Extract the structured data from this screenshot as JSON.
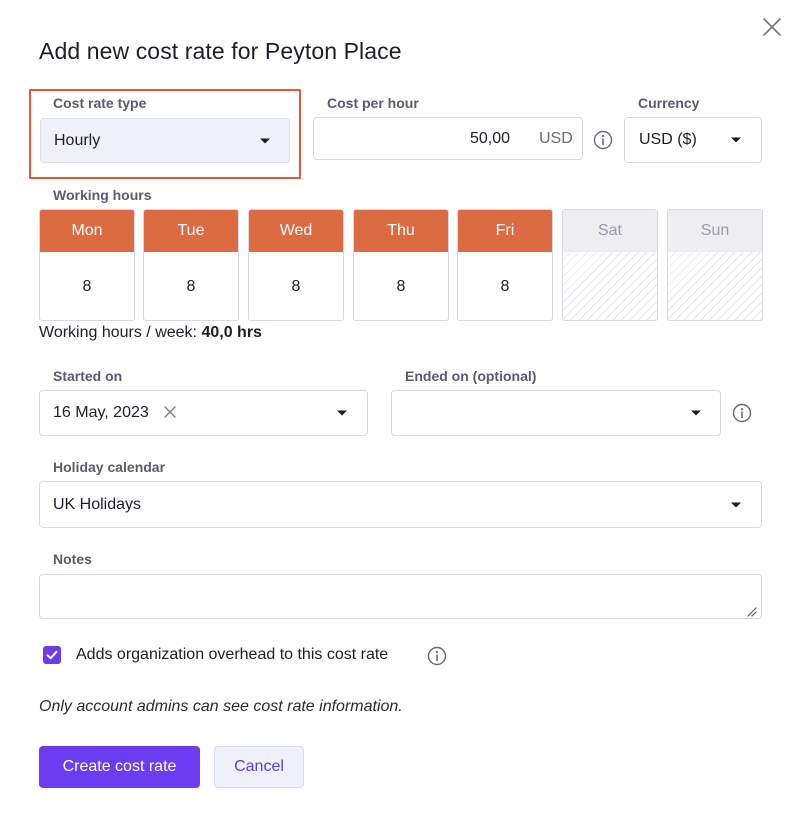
{
  "dialog": {
    "title": "Add new cost rate for Peyton Place",
    "close_icon": "close-icon"
  },
  "cost_rate_type": {
    "label": "Cost rate type",
    "value": "Hourly"
  },
  "cost_per_hour": {
    "label": "Cost per hour",
    "value": "50,00",
    "unit": "USD",
    "info_icon": "info-icon"
  },
  "currency": {
    "label": "Currency",
    "value": "USD ($)"
  },
  "working_hours": {
    "label": "Working hours",
    "days": [
      {
        "name": "Mon",
        "hours": "8",
        "active": true
      },
      {
        "name": "Tue",
        "hours": "8",
        "active": true
      },
      {
        "name": "Wed",
        "hours": "8",
        "active": true
      },
      {
        "name": "Thu",
        "hours": "8",
        "active": true
      },
      {
        "name": "Fri",
        "hours": "8",
        "active": true
      },
      {
        "name": "Sat",
        "hours": "",
        "active": false
      },
      {
        "name": "Sun",
        "hours": "",
        "active": false
      }
    ],
    "week_label": "Working hours / week:",
    "week_total": "40,0 hrs"
  },
  "started_on": {
    "label": "Started on",
    "value": "16 May, 2023"
  },
  "ended_on": {
    "label": "Ended on (optional)",
    "value": ""
  },
  "holiday_calendar": {
    "label": "Holiday calendar",
    "value": "UK Holidays"
  },
  "notes": {
    "label": "Notes",
    "value": ""
  },
  "overhead": {
    "label": "Adds organization overhead to this cost rate",
    "checked": true
  },
  "admin_note": "Only account admins can see cost rate information.",
  "buttons": {
    "create": "Create cost rate",
    "cancel": "Cancel"
  },
  "colors": {
    "accent": "#6b3cf0",
    "day_active": "#dd6b42",
    "highlight": "#e8563a"
  }
}
